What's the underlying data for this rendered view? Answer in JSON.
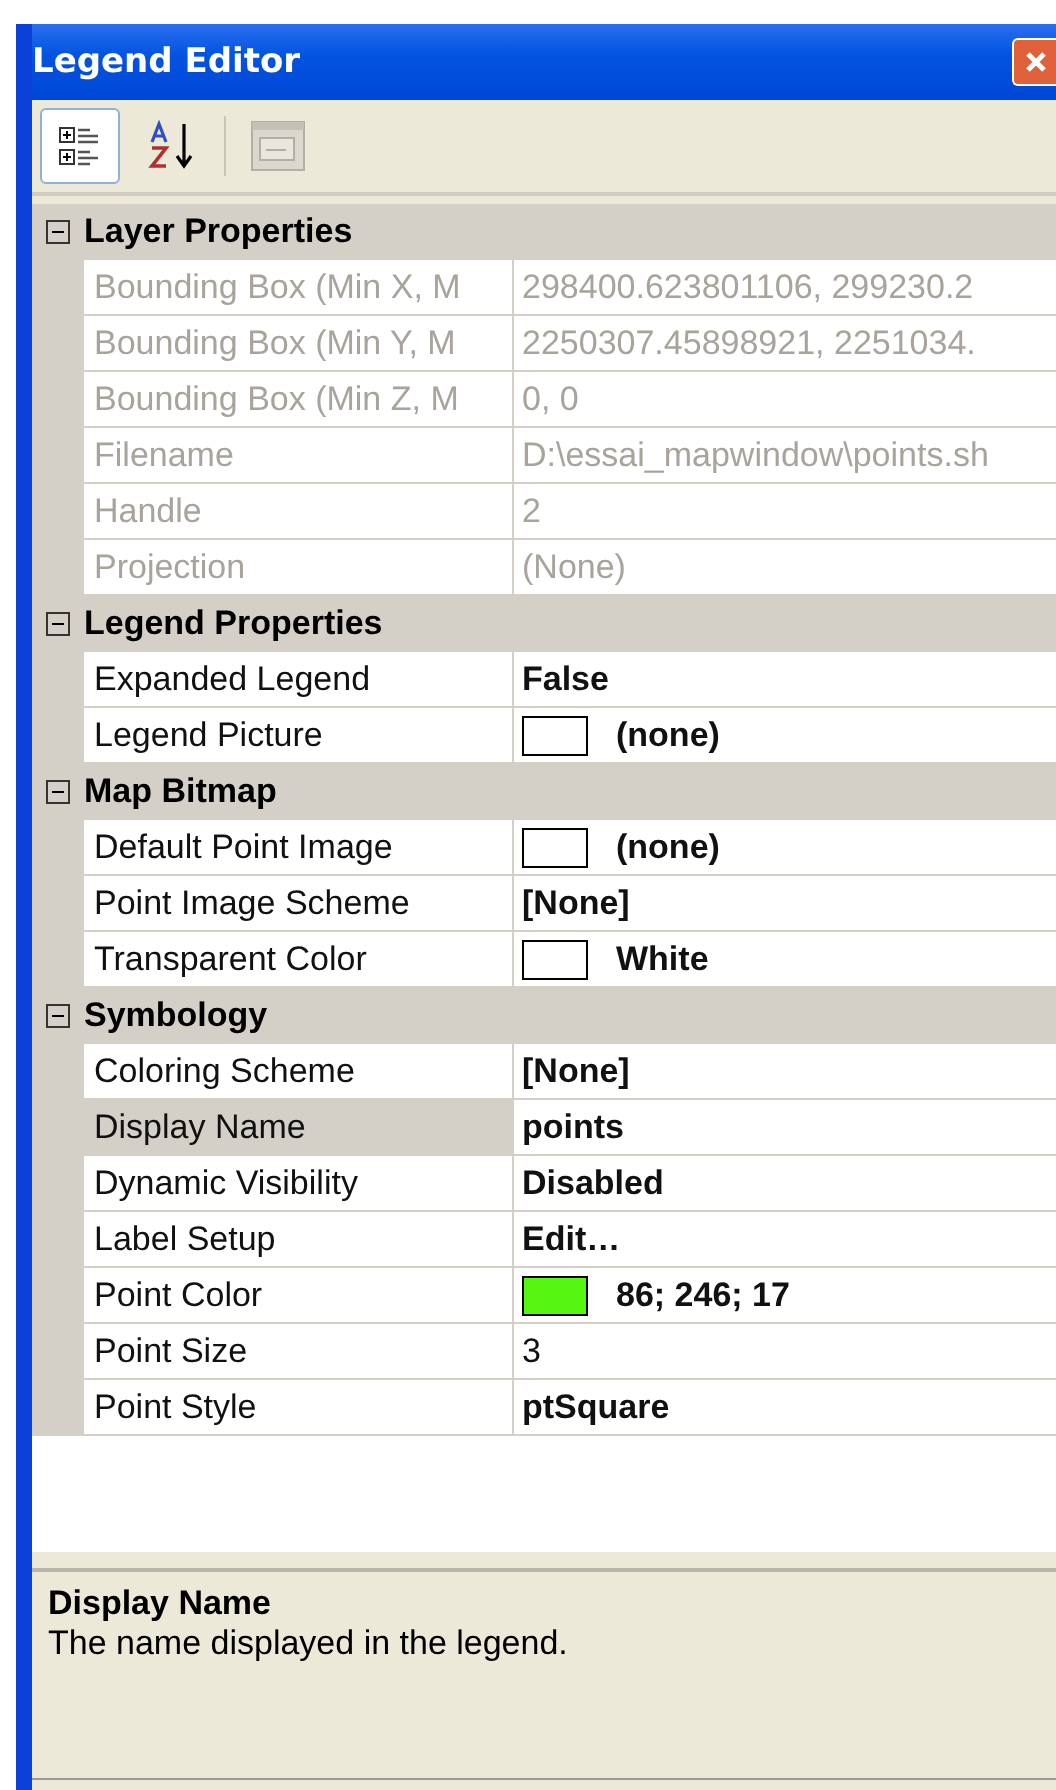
{
  "window": {
    "title": "Legend Editor"
  },
  "toolbar": [
    {
      "kind": "categorized",
      "selected": true,
      "disabled": false
    },
    {
      "kind": "alphabetical",
      "selected": false,
      "disabled": false
    },
    {
      "kind": "pages",
      "selected": false,
      "disabled": true
    }
  ],
  "categories": [
    {
      "name": "Layer Properties",
      "expanded": true,
      "properties": [
        {
          "label": "Bounding Box (Min X, M",
          "value": "298400.623801106, 299230.2",
          "disabled": true,
          "bold": false,
          "selected": false
        },
        {
          "label": "Bounding Box (Min Y, M",
          "value": "2250307.45898921, 2251034.",
          "disabled": true,
          "bold": false,
          "selected": false
        },
        {
          "label": "Bounding Box (Min Z, M",
          "value": "0, 0",
          "disabled": true,
          "bold": false,
          "selected": false
        },
        {
          "label": "Filename",
          "value": "D:\\essai_mapwindow\\points.sh",
          "disabled": true,
          "bold": false,
          "selected": false
        },
        {
          "label": "Handle",
          "value": "2",
          "disabled": true,
          "bold": false,
          "selected": false
        },
        {
          "label": "Projection",
          "value": "(None)",
          "disabled": true,
          "bold": false,
          "selected": false
        }
      ]
    },
    {
      "name": "Legend Properties",
      "expanded": true,
      "properties": [
        {
          "label": "Expanded Legend",
          "value": "False",
          "disabled": false,
          "bold": true,
          "selected": false
        },
        {
          "label": "Legend Picture",
          "value": "(none)",
          "disabled": false,
          "bold": true,
          "selected": false,
          "color": "#ffffff"
        }
      ]
    },
    {
      "name": "Map Bitmap",
      "expanded": true,
      "properties": [
        {
          "label": "Default Point Image",
          "value": "(none)",
          "disabled": false,
          "bold": true,
          "selected": false,
          "color": "#ffffff"
        },
        {
          "label": "Point Image Scheme",
          "value": "[None]",
          "disabled": false,
          "bold": true,
          "selected": false
        },
        {
          "label": "Transparent Color",
          "value": "White",
          "disabled": false,
          "bold": true,
          "selected": false,
          "color": "#ffffff"
        }
      ]
    },
    {
      "name": "Symbology",
      "expanded": true,
      "properties": [
        {
          "label": "Coloring Scheme",
          "value": "[None]",
          "disabled": false,
          "bold": true,
          "selected": false
        },
        {
          "label": "Display Name",
          "value": "points",
          "disabled": false,
          "bold": true,
          "selected": true
        },
        {
          "label": "Dynamic Visibility",
          "value": "Disabled",
          "disabled": false,
          "bold": true,
          "selected": false
        },
        {
          "label": "Label Setup",
          "value": "Edit…",
          "disabled": false,
          "bold": true,
          "selected": false
        },
        {
          "label": "Point Color",
          "value": "86; 246; 17",
          "disabled": false,
          "bold": true,
          "selected": false,
          "color": "#56f611"
        },
        {
          "label": "Point Size",
          "value": "3",
          "disabled": false,
          "bold": false,
          "selected": false
        },
        {
          "label": "Point Style",
          "value": "ptSquare",
          "disabled": false,
          "bold": true,
          "selected": false
        }
      ]
    }
  ],
  "description": {
    "title": "Display Name",
    "text": "The name displayed in the legend."
  }
}
